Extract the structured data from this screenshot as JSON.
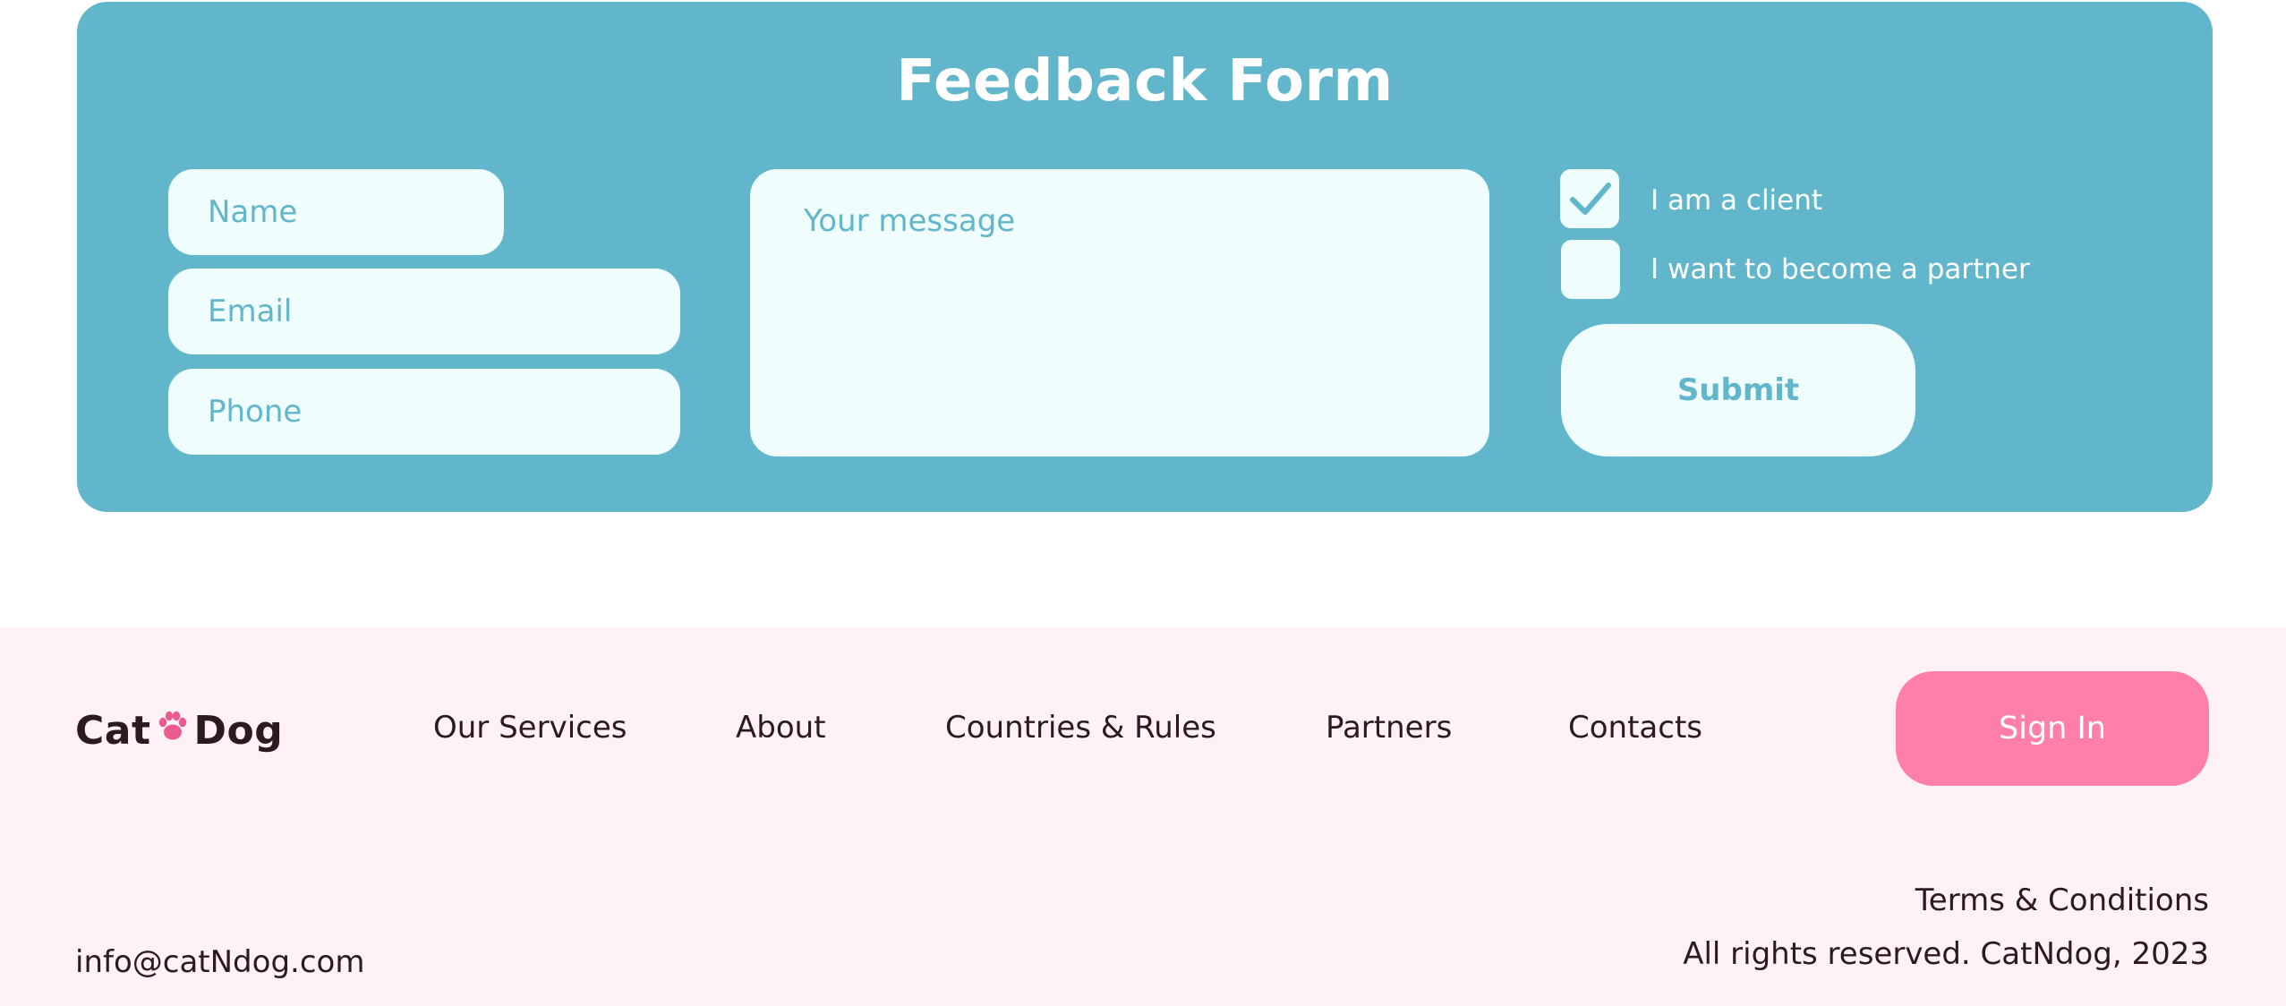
{
  "feedback_form": {
    "title": "Feedback Form",
    "name_placeholder": "Name",
    "email_placeholder": "Email",
    "phone_placeholder": "Phone",
    "message_placeholder": "Your message",
    "options": [
      {
        "label": "I am a client",
        "checked": true
      },
      {
        "label": "I want to become a partner",
        "checked": false
      }
    ],
    "submit_label": "Submit"
  },
  "footer": {
    "logo_left": "Cat",
    "logo_right": "Dog",
    "logo_icon": "paw-icon",
    "nav": [
      {
        "label": "Our Services"
      },
      {
        "label": "About"
      },
      {
        "label": "Countries & Rules"
      },
      {
        "label": "Partners"
      },
      {
        "label": "Contacts"
      }
    ],
    "signin_label": "Sign In",
    "email": "info@catNdog.com",
    "terms_label": "Terms & Conditions",
    "copyright": "All rights reserved. CatNdog, 2023"
  },
  "colors": {
    "card_bg": "#62b6cb",
    "field_bg": "#effdfd",
    "footer_bg": "#fef2f6",
    "accent_pink": "#ff7fa9",
    "text_dark": "#2b1b1f"
  }
}
